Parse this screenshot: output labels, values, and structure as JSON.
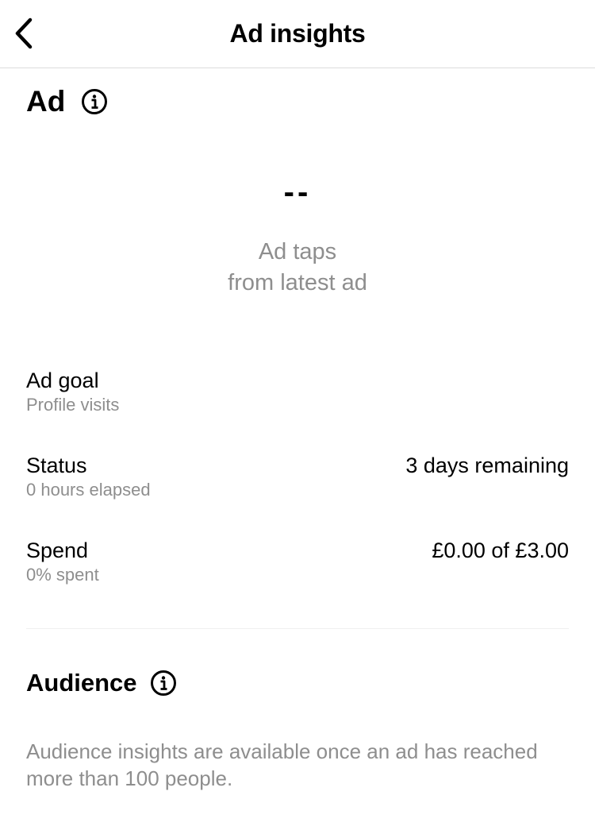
{
  "header": {
    "title": "Ad insights",
    "back_icon": "chevron-left-icon"
  },
  "ad_section": {
    "heading": "Ad",
    "info_icon": "info-icon",
    "metric_value": "--",
    "metric_caption_line1": "Ad taps",
    "metric_caption_line2": "from latest ad"
  },
  "details": {
    "goal": {
      "label": "Ad goal",
      "sub": "Profile visits"
    },
    "status": {
      "label": "Status",
      "sub": "0 hours elapsed",
      "value": "3 days remaining"
    },
    "spend": {
      "label": "Spend",
      "sub": "0% spent",
      "value": "£0.00 of £3.00"
    }
  },
  "audience_section": {
    "heading": "Audience",
    "info_icon": "info-icon",
    "text": "Audience insights are available once an ad has reached more than 100 people."
  },
  "colors": {
    "text_primary": "#000000",
    "text_secondary": "#8e8e8e",
    "divider": "#efefef",
    "background": "#ffffff"
  }
}
